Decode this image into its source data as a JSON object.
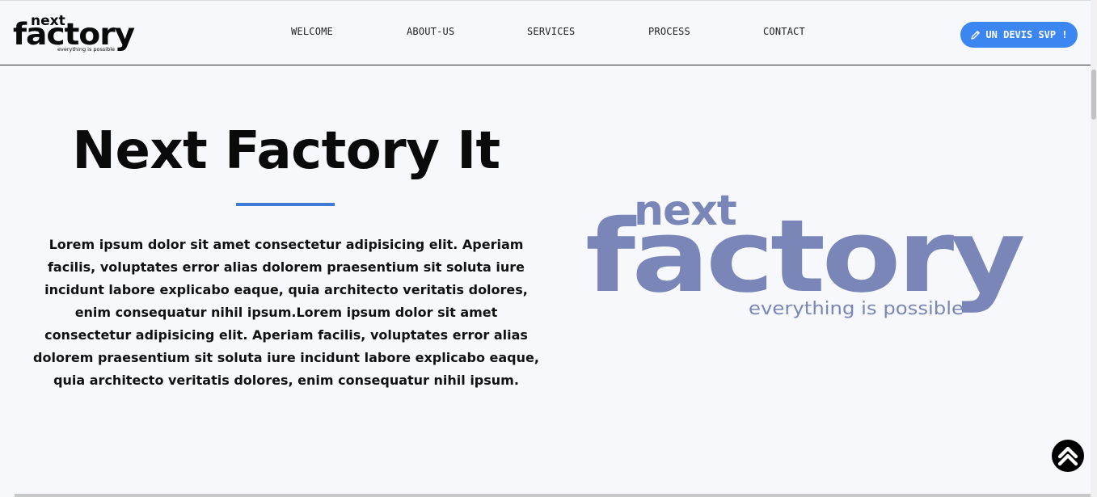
{
  "header": {
    "logo": {
      "top": "next",
      "main": "factory",
      "tagline": "everything is possible"
    },
    "nav": [
      "WELCOME",
      "ABOUT-US",
      "SERVICES",
      "PROCESS",
      "CONTACT"
    ],
    "cta_label": "UN DEVIS SVP !"
  },
  "hero": {
    "title": "Next Factory It",
    "text": "Lorem ipsum dolor sit amet consectetur adipisicing elit. Aperiam facilis, voluptates error alias dolorem praesentium sit soluta iure incidunt labore explicabo eaque, quia architecto veritatis dolores, enim consequatur nihil ipsum.Lorem ipsum dolor sit amet consectetur adipisicing elit. Aperiam facilis, voluptates error alias dolorem praesentium sit soluta iure incidunt labore explicabo eaque, quia architecto veritatis dolores, enim consequatur nihil ipsum.",
    "logo": {
      "top": "next",
      "main": "factory",
      "tagline": "everything is possible"
    }
  },
  "colors": {
    "accent": "#3b86f0",
    "underline": "#3f7bd6",
    "logo_big": "#7a86b8",
    "text": "#111111"
  },
  "icons": {
    "cta": "pencil-icon",
    "back_to_top": "double-chevron-up-icon"
  }
}
